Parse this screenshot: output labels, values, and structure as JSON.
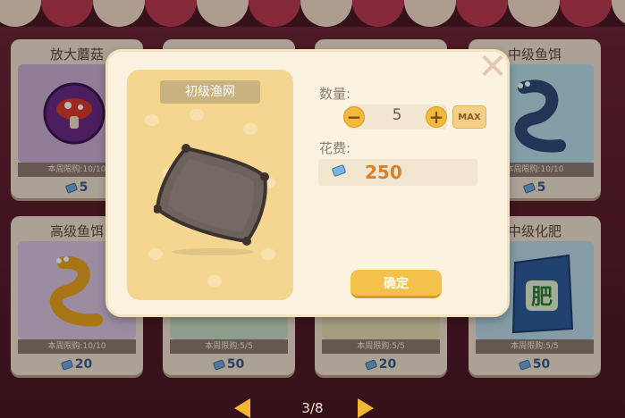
{
  "background_cards": [
    {
      "title": "放大蘑菇",
      "limit": "本周限购:10/10",
      "price": "5",
      "color": "#c9aed2"
    },
    {
      "title": "",
      "limit": "",
      "price": "",
      "color": "#e7dccd"
    },
    {
      "title": "",
      "limit": "",
      "price": "",
      "color": "#e7dccd"
    },
    {
      "title": "中级鱼饵",
      "limit": "本周限购:10/10",
      "price": "5",
      "color": "#b8dbe8"
    },
    {
      "title": "高级鱼饵",
      "limit": "本周限购:10/10",
      "price": "20",
      "color": "#d7c3df"
    },
    {
      "title": "",
      "limit": "本周限购:5/5",
      "price": "50",
      "color": "#c7dcc3"
    },
    {
      "title": "",
      "limit": "本周限购:5/5",
      "price": "20",
      "color": "#e4dcb0"
    },
    {
      "title": "中级化肥",
      "limit": "本周限购:5/5",
      "price": "50",
      "color": "#b6d8e6"
    }
  ],
  "pager": {
    "text": "3/8"
  },
  "modal": {
    "item_name": "初级渔网",
    "quantity_label": "数量:",
    "quantity": "5",
    "minus": "−",
    "plus": "+",
    "max_label": "MAX",
    "cost_label": "花费:",
    "cost_value": "250",
    "confirm_label": "确定",
    "close": "✕"
  }
}
